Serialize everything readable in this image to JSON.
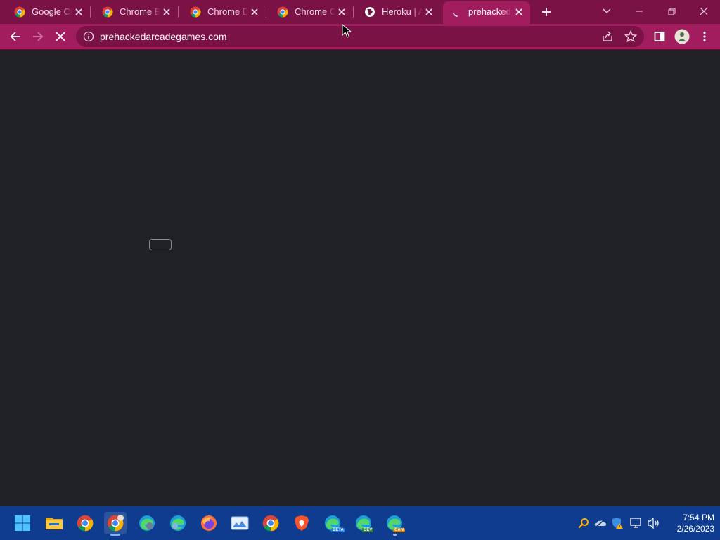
{
  "browser": {
    "tabs": [
      {
        "title": "Google Chr",
        "favicon": "chrome-icon"
      },
      {
        "title": "Chrome Be",
        "favicon": "chrome-icon"
      },
      {
        "title": "Chrome De",
        "favicon": "chrome-icon"
      },
      {
        "title": "Chrome Ca",
        "favicon": "chrome-icon"
      },
      {
        "title": "Heroku | A",
        "favicon": "globe-icon"
      },
      {
        "title": "prehackeda",
        "favicon": "loading-spinner-icon",
        "active": true
      }
    ],
    "new_tab_icon": "plus-icon",
    "window_controls": [
      "chevron-down-icon",
      "minimize-icon",
      "restore-icon",
      "close-icon"
    ]
  },
  "toolbar": {
    "back_icon": "arrow-left-icon",
    "forward_icon": "arrow-right-icon",
    "stop_icon": "stop-x-icon",
    "url": "prehackedarcadegames.com",
    "site_info_icon": "info-icon",
    "share_icon": "share-icon",
    "bookmark_icon": "star-icon",
    "sidepanel_icon": "side-panel-icon",
    "profile_icon": "avatar-icon",
    "menu_icon": "kebab-menu-icon"
  },
  "colors": {
    "frame": "#7b1245",
    "toolbar": "#a21d5e",
    "page_bg": "#202124",
    "taskbar": "#0f3c8f"
  },
  "taskbar": {
    "apps": [
      "windows-start-icon",
      "file-explorer-icon",
      "chrome-icon",
      "chrome-canary-icon",
      "edge-icon",
      "edge-profile-icon",
      "firefox-icon",
      "photo-viewer-icon",
      "chrome-icon",
      "brave-icon",
      "edge-beta-icon",
      "edge-dev-icon",
      "edge-canary-icon"
    ],
    "badges": {
      "beta": "BETA",
      "dev": "DEV",
      "canary": "CAN"
    },
    "tray_icons": [
      "search-tray-icon",
      "onedrive-icon",
      "security-warning-icon",
      "network-icon",
      "volume-icon"
    ],
    "clock": {
      "time": "7:54 PM",
      "date": "2/26/2023"
    }
  }
}
